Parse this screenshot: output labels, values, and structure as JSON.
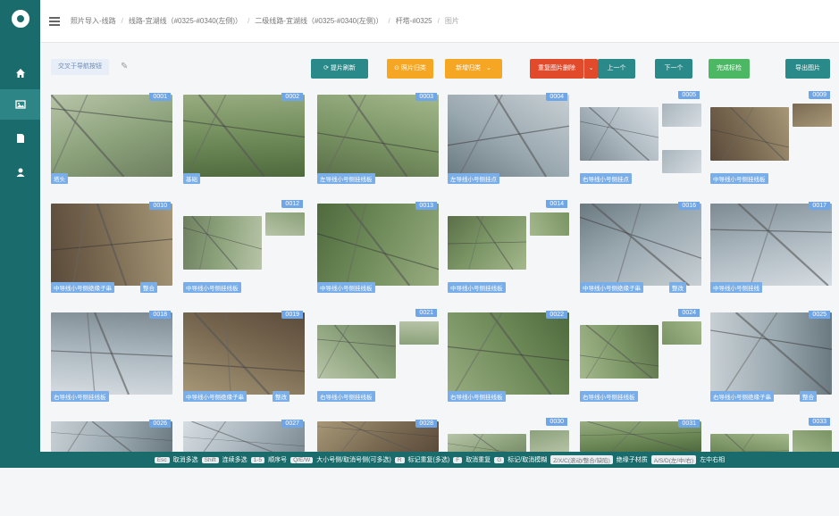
{
  "sidebar": {
    "items": [
      {
        "name": "home-icon"
      },
      {
        "name": "image-icon",
        "active": true
      },
      {
        "name": "document-icon"
      },
      {
        "name": "user-icon"
      }
    ]
  },
  "breadcrumb": [
    "照片导入-线路",
    "线路-宜湖线（#0325-#0340(左侧)）",
    "二级线路-宜湖线（#0325-#0340(左侧)）",
    "杆塔-#0325",
    "图片"
  ],
  "toolbar": {
    "select_all": "交叉于导航按钮",
    "buttons": [
      {
        "label": "提片刷新"
      },
      {
        "label": "照片归类"
      },
      {
        "label": "新增归类"
      },
      {
        "label": "重复图片删除"
      },
      {
        "label": "上一个"
      },
      {
        "label": "下一个"
      },
      {
        "label": "完成标检"
      },
      {
        "label": "导出图片"
      }
    ]
  },
  "photos": [
    {
      "num": "0001",
      "tag": "塔头",
      "tag2": ""
    },
    {
      "num": "0002",
      "tag": "基础",
      "tag2": ""
    },
    {
      "num": "0003",
      "tag": "左导线小号侧挂线板",
      "tag2": ""
    },
    {
      "num": "0004",
      "tag": "左导线小号侧挂点",
      "tag2": ""
    },
    {
      "num": "0005",
      "tag": "右导线小号侧挂点",
      "tag2": ""
    },
    {
      "num": "0009",
      "tag": "中导线小号侧挂线板",
      "tag2": ""
    },
    {
      "num": "0010",
      "tag": "中导线小号侧绝缘子串",
      "tag2": "整合"
    },
    {
      "num": "0012",
      "tag": "中导线小号侧挂线板",
      "tag2": ""
    },
    {
      "num": "0013",
      "tag": "中导线小号侧挂线板",
      "tag2": ""
    },
    {
      "num": "0014",
      "tag": "中导线小号侧挂线板",
      "tag2": ""
    },
    {
      "num": "0016",
      "tag": "中导线小号侧绝缘子串",
      "tag2": "整改"
    },
    {
      "num": "0017",
      "tag": "中导线小号侧挂线",
      "tag2": ""
    },
    {
      "num": "0018",
      "tag": "右导线小号侧挂线板",
      "tag2": ""
    },
    {
      "num": "0019",
      "tag": "中导线小号侧绝缘子串",
      "tag2": "整改"
    },
    {
      "num": "0021",
      "tag": "右导线小号侧挂线板",
      "tag2": ""
    },
    {
      "num": "0022",
      "tag": "右导线小号侧挂线板",
      "tag2": ""
    },
    {
      "num": "0024",
      "tag": "右导线小号侧挂线板",
      "tag2": ""
    },
    {
      "num": "0025",
      "tag": "右导线小号侧绝缘子串",
      "tag2": "整合"
    },
    {
      "num": "0026",
      "tag": "",
      "tag2": ""
    },
    {
      "num": "0027",
      "tag": "",
      "tag2": ""
    },
    {
      "num": "0028",
      "tag": "",
      "tag2": ""
    },
    {
      "num": "0030",
      "tag": "",
      "tag2": ""
    },
    {
      "num": "0031",
      "tag": "",
      "tag2": ""
    },
    {
      "num": "0033",
      "tag": "",
      "tag2": ""
    }
  ],
  "footer": [
    {
      "key": "Esc",
      "label": "取消多选"
    },
    {
      "key": "Shift",
      "label": "连续多选"
    },
    {
      "key": "1-5",
      "label": "顺序号"
    },
    {
      "key": "Q/E/W",
      "label": "大小号侧/取消号侧(可多选)"
    },
    {
      "key": "R",
      "label": "标记重复(多选)"
    },
    {
      "key": "F",
      "label": "取消重复"
    },
    {
      "key": "G",
      "label": "标记/取消模糊"
    },
    {
      "key": "Z/X/C(滚动/整合/缺陷)",
      "label": "绝缘子材质"
    },
    {
      "key": "A/S/D(左/中/右)",
      "label": "左中右相"
    }
  ],
  "colors": {
    "primary": "#1a6b6b",
    "tag": "#7aaee8",
    "orange": "#f5a623",
    "red": "#e24a2c",
    "green": "#4cb864"
  }
}
